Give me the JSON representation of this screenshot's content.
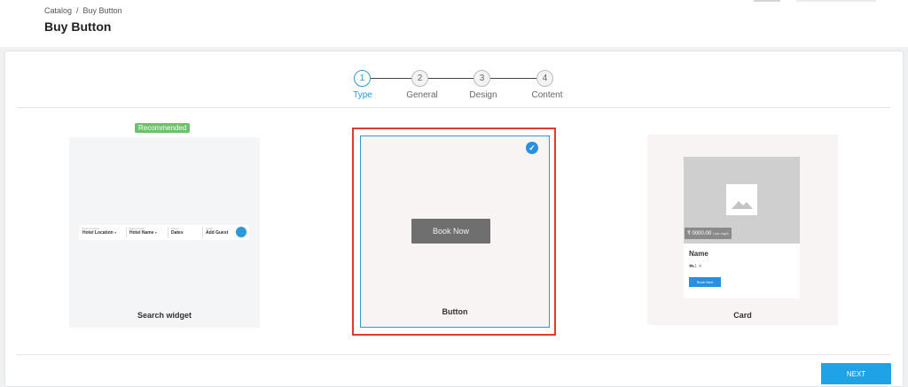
{
  "breadcrumb": {
    "items": [
      "Catalog",
      "/",
      "Buy Button"
    ]
  },
  "page": {
    "title": "Buy Button"
  },
  "stepper": {
    "steps": [
      {
        "number": "1",
        "label": "Type"
      },
      {
        "number": "2",
        "label": "General"
      },
      {
        "number": "3",
        "label": "Design"
      },
      {
        "number": "4",
        "label": "Content"
      }
    ],
    "active": "1"
  },
  "options": {
    "search_widget": {
      "badge": "Recommended",
      "label": "Search widget",
      "fields": [
        {
          "small": "Hotel Location",
          "value": "Hotel Location"
        },
        {
          "small": "Select Hotel",
          "value": "Hotel Name"
        },
        {
          "small": "When",
          "value": "Dates"
        },
        {
          "small": "Guest",
          "value": "Add Guest"
        }
      ]
    },
    "button": {
      "label": "Button",
      "preview_label": "Book Now",
      "selected": true
    },
    "card": {
      "label": "Card",
      "price": "₹ 0000.00",
      "per": "/ per night",
      "name": "Name",
      "icons": "⛟1  ✕",
      "book_label": "Book Now"
    }
  },
  "footer": {
    "next_label": "NEXT"
  },
  "colors": {
    "accent": "#2a9ad8",
    "selected_border": "#e23a2d",
    "badge": "#6cc16b",
    "next": "#20a3e6"
  }
}
